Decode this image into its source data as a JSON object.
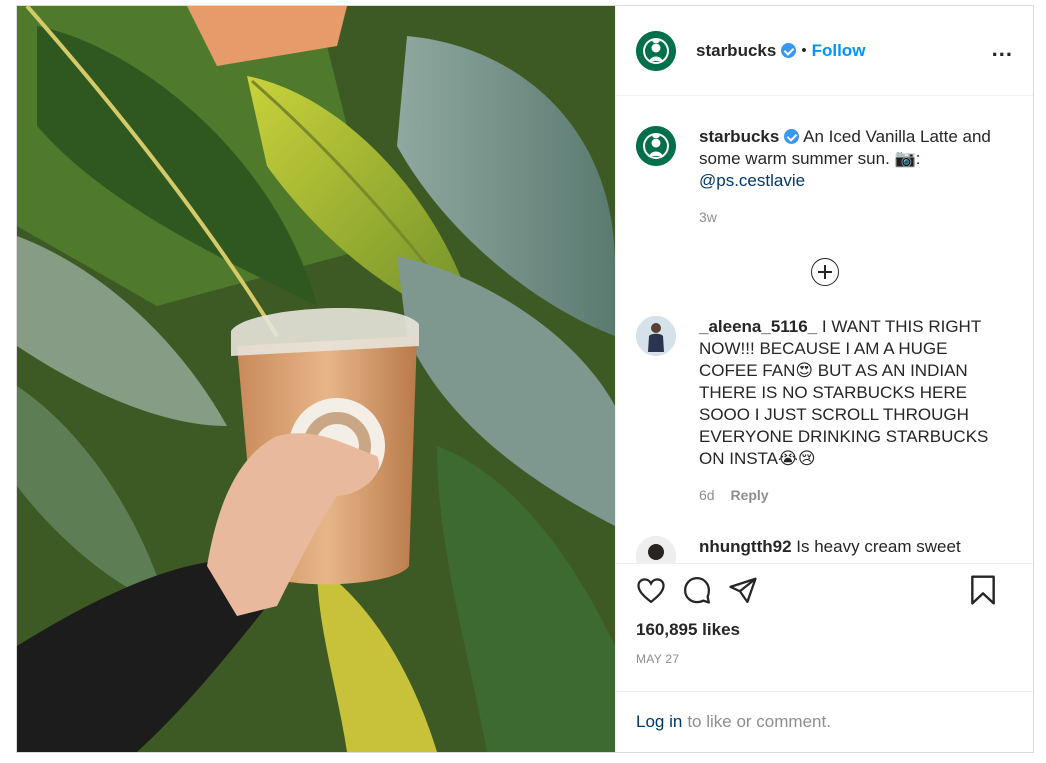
{
  "post": {
    "image": {
      "subject": "Hand holding an Iced Vanilla Latte in a clear Starbucks cup in front of banana-leaf foliage"
    },
    "header": {
      "username": "starbucks",
      "separator": "•",
      "follow_label": "Follow",
      "more_label": "..."
    },
    "caption": {
      "username": "starbucks",
      "text": "An Iced Vanilla Latte and some warm summer sun. 📷:",
      "mention": "@ps.cestlavie",
      "age": "3w"
    },
    "comments": [
      {
        "username": "_aleena_5116_",
        "text": "I WANT THIS RIGHT NOW!!! BECAUSE I AM A HUGE COFEE FAN😍 BUT AS AN INDIAN THERE IS NO STARBUCKS HERE SOOO I JUST SCROLL THROUGH EVERYONE DRINKING STARBUCKS ON INSTA😭😢",
        "age": "6d",
        "reply_label": "Reply"
      },
      {
        "username": "nhungtth92",
        "text": "Is heavy cream sweet"
      }
    ],
    "likes": "160,895 likes",
    "date": "MAY 27",
    "login": {
      "link": "Log in",
      "text": "to like or comment."
    }
  },
  "colors": {
    "link_blue": "#0095f6",
    "verified_blue": "#3897f0",
    "starbucks_green": "#00704a",
    "muted": "#8e8e8e"
  },
  "icons": [
    "verified-badge-icon",
    "more-options-icon",
    "load-more-comments-icon",
    "heart-icon",
    "comment-icon",
    "share-icon",
    "bookmark-icon"
  ]
}
